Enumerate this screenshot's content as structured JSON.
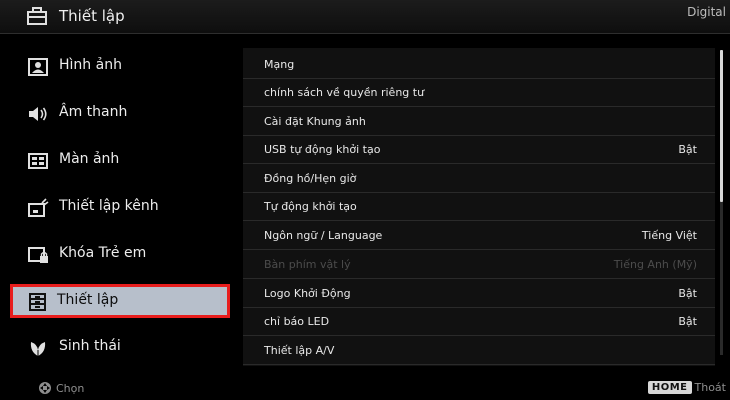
{
  "header": {
    "title": "Thiết lập",
    "source": "Digital"
  },
  "sidebar": {
    "items": [
      {
        "label": "Hình ảnh",
        "icon": "picture-icon"
      },
      {
        "label": "Âm thanh",
        "icon": "speaker-icon"
      },
      {
        "label": "Màn ảnh",
        "icon": "screen-icon"
      },
      {
        "label": "Thiết lập kênh",
        "icon": "channel-setup-icon"
      },
      {
        "label": "Khóa Trẻ em",
        "icon": "parental-lock-icon"
      },
      {
        "label": "Thiết lập",
        "icon": "settings-toolbox-icon",
        "selected": true
      },
      {
        "label": "Sinh thái",
        "icon": "eco-leaf-icon"
      }
    ]
  },
  "menu": {
    "rows": [
      {
        "label": "Mạng",
        "value": ""
      },
      {
        "label": "chính sách về quyền riêng tư",
        "value": ""
      },
      {
        "label": "Cài đặt Khung ảnh",
        "value": ""
      },
      {
        "label": "USB tự động khởi tạo",
        "value": "Bật"
      },
      {
        "label": "Đồng hồ/Hẹn giờ",
        "value": ""
      },
      {
        "label": "Tự động khởi tạo",
        "value": ""
      },
      {
        "label": "Ngôn ngữ / Language",
        "value": "Tiếng Việt"
      },
      {
        "label": "Bàn phím vật lý",
        "value": "Tiếng Anh (Mỹ)",
        "disabled": true
      },
      {
        "label": "Logo Khởi Động",
        "value": "Bật"
      },
      {
        "label": "chỉ báo LED",
        "value": "Bật"
      },
      {
        "label": "Thiết lập A/V",
        "value": ""
      }
    ]
  },
  "footer": {
    "select_label": "Chọn",
    "home_key": "HOME",
    "exit_label": "Thoát"
  },
  "colors": {
    "selection_bg": "#b7bfcb",
    "highlight_border": "#e81d1d"
  }
}
